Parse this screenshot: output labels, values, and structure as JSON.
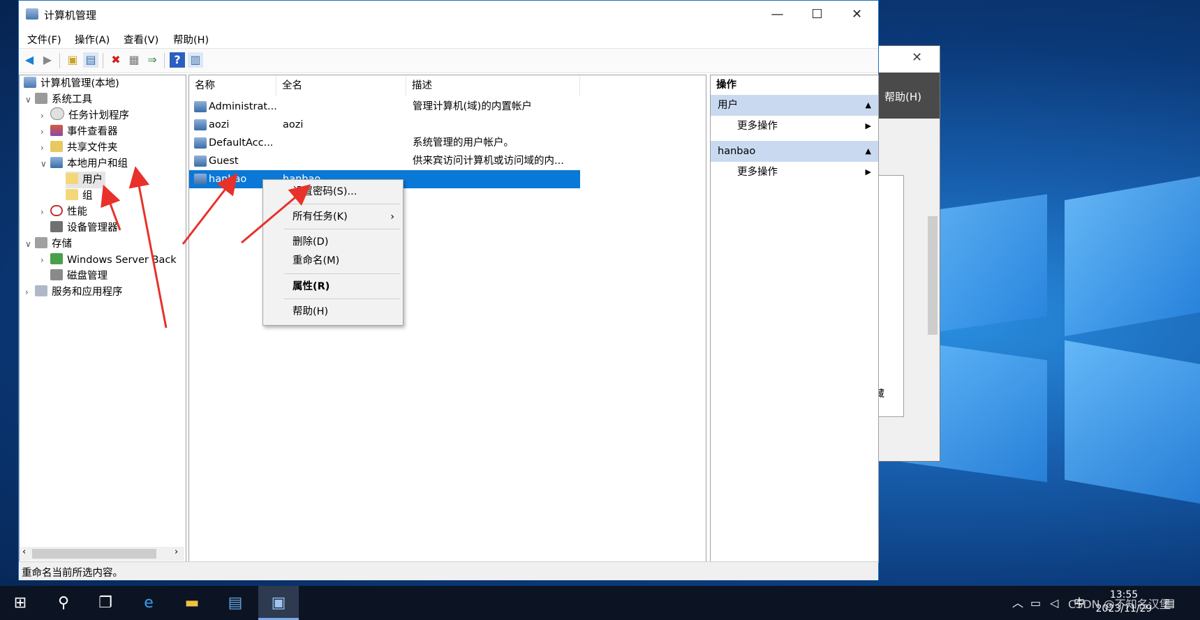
{
  "window": {
    "title": "计算机管理",
    "minimize": "—",
    "maximize": "☐",
    "close": "✕"
  },
  "menu": [
    "文件(F)",
    "操作(A)",
    "查看(V)",
    "帮助(H)"
  ],
  "tree": {
    "root": "计算机管理(本地)",
    "system_tools": "系统工具",
    "task_scheduler": "任务计划程序",
    "event_viewer": "事件查看器",
    "shared_folders": "共享文件夹",
    "local_users_groups": "本地用户和组",
    "users": "用户",
    "groups": "组",
    "performance": "性能",
    "device_manager": "设备管理器",
    "storage": "存储",
    "wsb": "Windows Server Back",
    "disk_mgmt": "磁盘管理",
    "services_apps": "服务和应用程序"
  },
  "list": {
    "headers": [
      "名称",
      "全名",
      "描述"
    ],
    "rows": [
      {
        "name": "Administrat...",
        "full": "",
        "desc": "管理计算机(域)的内置帐户"
      },
      {
        "name": "aozi",
        "full": "aozi",
        "desc": ""
      },
      {
        "name": "DefaultAcc...",
        "full": "",
        "desc": "系统管理的用户帐户。"
      },
      {
        "name": "Guest",
        "full": "",
        "desc": "供来宾访问计算机或访问域的内..."
      },
      {
        "name": "hanbao",
        "full": "hanbao",
        "desc": ""
      }
    ]
  },
  "context_menu": {
    "set_password": "设置密码(S)...",
    "all_tasks": "所有任务(K)",
    "delete": "删除(D)",
    "rename": "重命名(M)",
    "properties": "属性(R)",
    "help": "帮助(H)"
  },
  "actions": {
    "header": "操作",
    "section1": "用户",
    "more1": "更多操作",
    "section2": "hanbao",
    "more2": "更多操作"
  },
  "status": "重命名当前所选内容。",
  "bg_window": {
    "menu": "帮助(H)",
    "snippet": "藏"
  },
  "taskbar": {
    "time": "13:55",
    "date": "2023/11/29",
    "ime": "中",
    "watermark": "CSDN @不知名汉堡"
  },
  "colors": {
    "selection": "#0a78d7",
    "arrow": "#e8312a",
    "action_section": "#c9daf0"
  }
}
